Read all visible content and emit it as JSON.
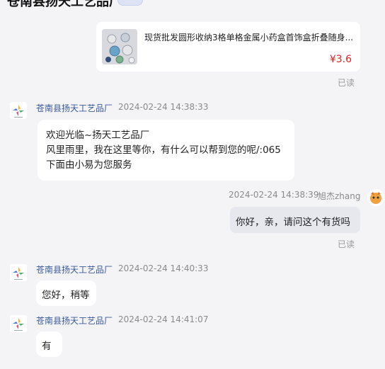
{
  "header": {
    "title": "苍南县扬天工艺品厂"
  },
  "product": {
    "title": "现货批发圆形收纳3格单格金属小药盒首饰盒折叠随身...",
    "price": "¥3.6"
  },
  "read_label": "已读",
  "shop_name": "苍南县扬天工艺品厂",
  "messages": [
    {
      "time": "2024-02-24 14:38:33",
      "lines": [
        "欢迎光临~扬天工艺品厂",
        "风里雨里，我在这里等你，有什么可以帮到您的呢/:065",
        "下面由小易为您服务"
      ]
    },
    {
      "user": "旭杰zhang",
      "time": "2024-02-24 14:38:39",
      "text": "你好，亲，请问这个有货吗"
    },
    {
      "time": "2024-02-24 14:40:33",
      "text": "您好，稍等"
    },
    {
      "time": "2024-02-24 14:41:07",
      "text": "有"
    }
  ]
}
